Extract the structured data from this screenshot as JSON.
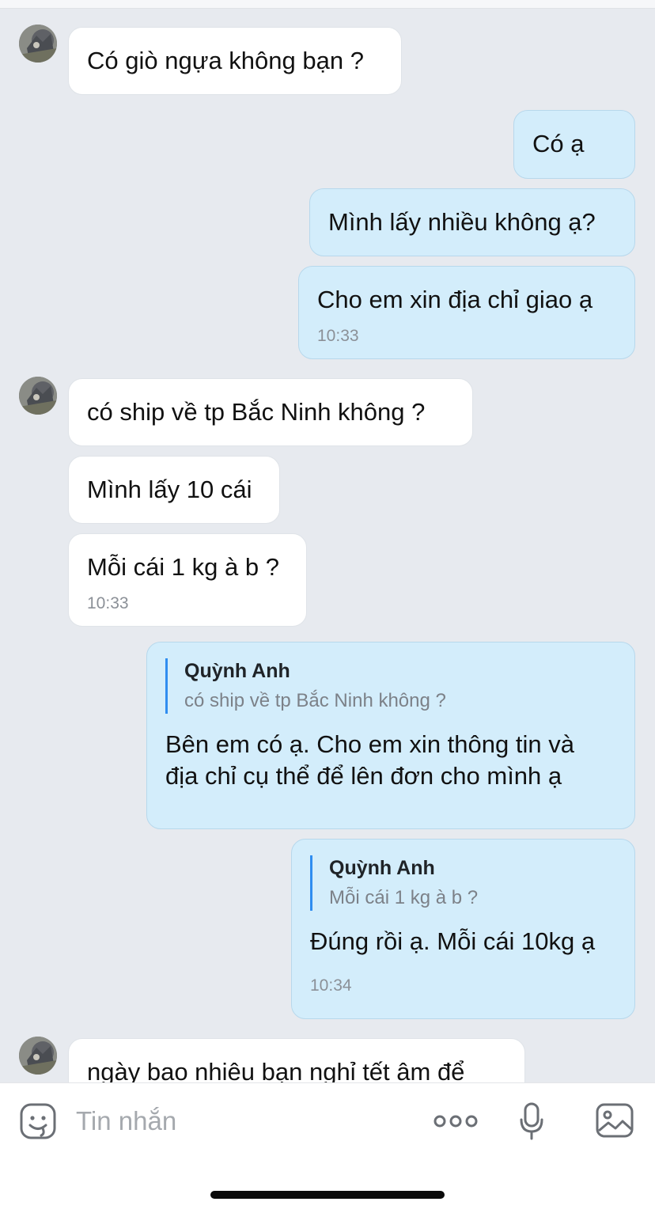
{
  "contact": {
    "name": "Quỳnh Anh"
  },
  "messages": [
    {
      "text": "Có giò ngựa không bạn ?"
    },
    {
      "text": "Có ạ"
    },
    {
      "text": "Mình lấy nhiều không ạ?"
    },
    {
      "text": "Cho em xin địa chỉ giao ạ",
      "time": "10:33"
    },
    {
      "text": "có ship về tp Bắc Ninh không ?"
    },
    {
      "text": "Mình lấy 10 cái"
    },
    {
      "text": "Mỗi cái 1 kg à b ?",
      "time": "10:33"
    },
    {
      "quote_name": "Quỳnh Anh",
      "quote_text": "có ship về tp Bắc Ninh không ?",
      "text_line1": "Bên em có ạ. Cho em xin thông tin và",
      "text_line2": "địa chỉ cụ thể để lên đơn cho mình ạ"
    },
    {
      "quote_name": "Quỳnh Anh",
      "quote_text": "Mỗi cái 1 kg à b ?",
      "text": "Đúng rồi ạ. Mỗi cái 10kg ạ",
      "time": "10:34"
    },
    {
      "text": "ngày bao nhiêu bạn nghỉ tết âm để"
    }
  ],
  "composer": {
    "placeholder": "Tin nhắn",
    "icons": [
      "sticker-icon",
      "more-icon",
      "microphone-icon",
      "image-icon"
    ]
  },
  "colors": {
    "chat_background": "#e7eaef",
    "incoming_bubble": "#ffffff",
    "outgoing_bubble": "#d3edfb",
    "quote_bar": "#2f8df0",
    "timestamp": "#8b9097"
  }
}
